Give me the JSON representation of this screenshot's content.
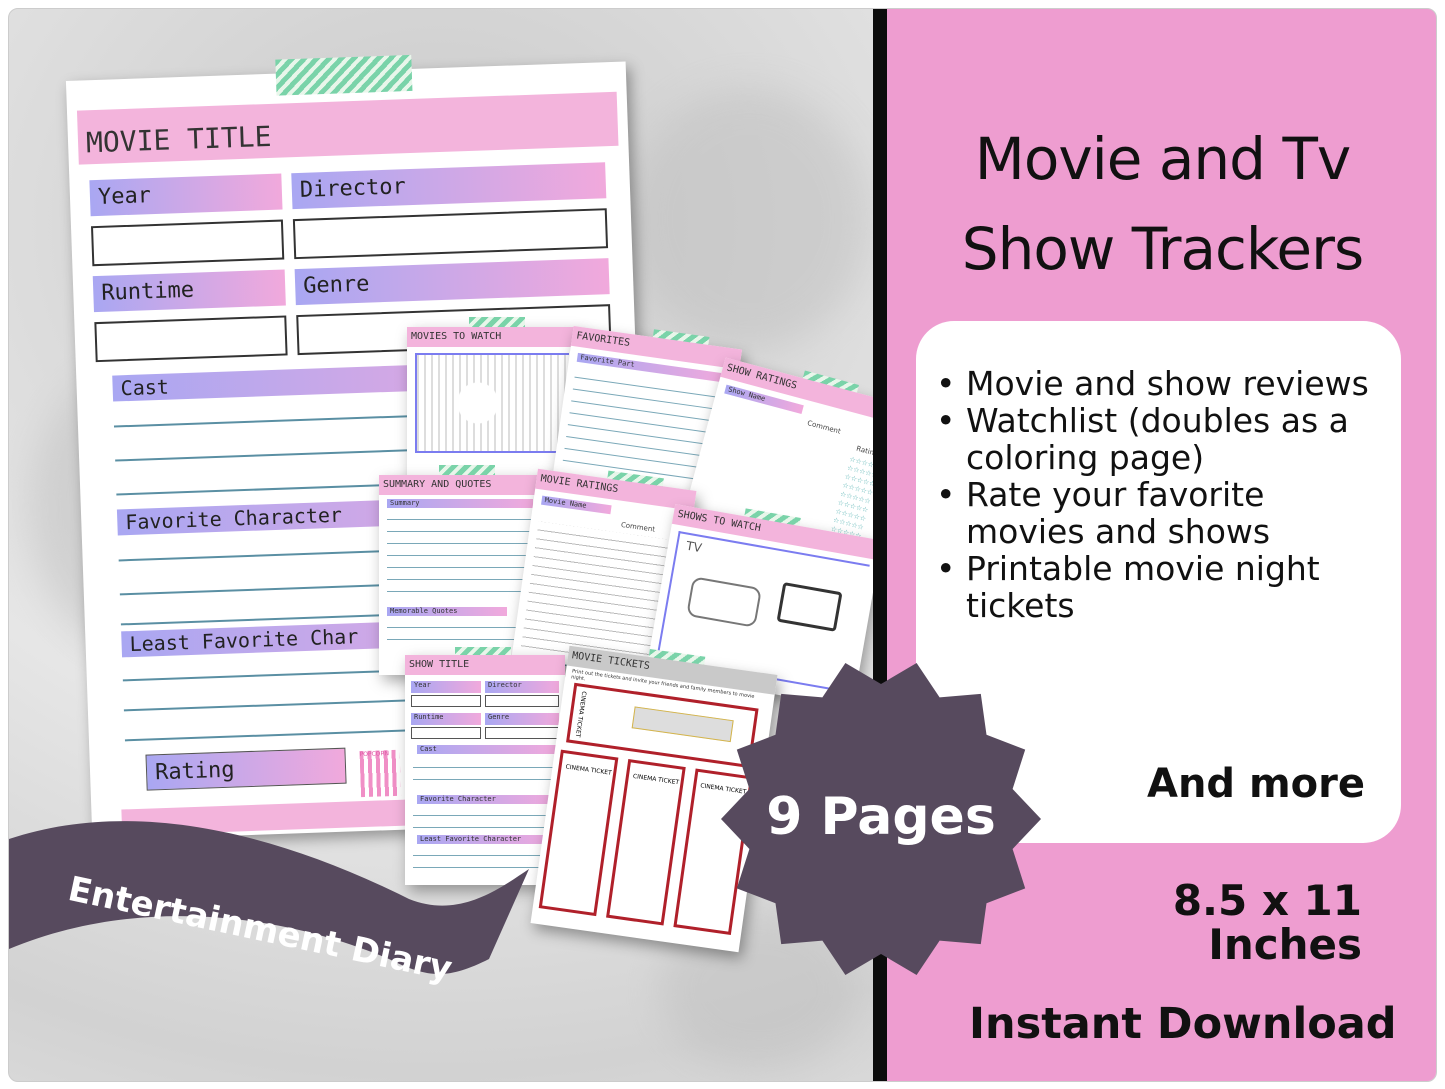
{
  "hero": {
    "title_line1": "Movie and Tv",
    "title_line2": "Show Trackers"
  },
  "features": [
    "Movie and show reviews",
    "Watchlist (doubles as a coloring page)",
    "Rate your favorite movies and shows",
    "Printable movie night tickets"
  ],
  "and_more": "And more",
  "size": {
    "line1": "8.5 x 11",
    "line2": "Inches"
  },
  "instant_download": "Instant Download",
  "badge": "9 Pages",
  "ribbon": "Entertainment Diary",
  "main_page": {
    "title": "MOVIE TITLE",
    "year": "Year",
    "director": "Director",
    "runtime": "Runtime",
    "genre": "Genre",
    "cast": "Cast",
    "favorite_character": "Favorite Character",
    "least_favorite": "Least Favorite Char",
    "rating": "Rating",
    "popcorn": "POPCORN"
  },
  "mini_pages": {
    "movies_to_watch": "MOVIES TO WATCH",
    "favorites": {
      "title": "FAVORITES",
      "label": "Favorite Part"
    },
    "show_ratings": {
      "title": "SHOW RATINGS",
      "show_name": "Show Name",
      "comment": "Comment",
      "rating": "Rating"
    },
    "summary": {
      "title": "SUMMARY AND QUOTES",
      "summary": "Summary",
      "quotes": "Memorable Quotes"
    },
    "movie_ratings": {
      "title": "MOVIE RATINGS",
      "movie_name": "Movie Name",
      "comment": "Comment"
    },
    "shows_to_watch": {
      "title": "SHOWS TO WATCH",
      "tv": "TV"
    },
    "show_title": {
      "title": "SHOW TITLE",
      "year": "Year",
      "director": "Director",
      "runtime": "Runtime",
      "genre": "Genre",
      "cast": "Cast",
      "favorite_character": "Favorite Character",
      "least_favorite": "Least Favorite Character"
    },
    "movie_tickets": {
      "title": "MOVIE TICKETS",
      "instructions": "Print out the tickets and invite your friends and family members to movie night.",
      "ticket": "CINEMA TICKET"
    }
  },
  "colors": {
    "pink": "#ee9dd0",
    "header_pink": "#f3b4dc",
    "badge": "#574a5e",
    "ticket_red": "#b0202a"
  }
}
